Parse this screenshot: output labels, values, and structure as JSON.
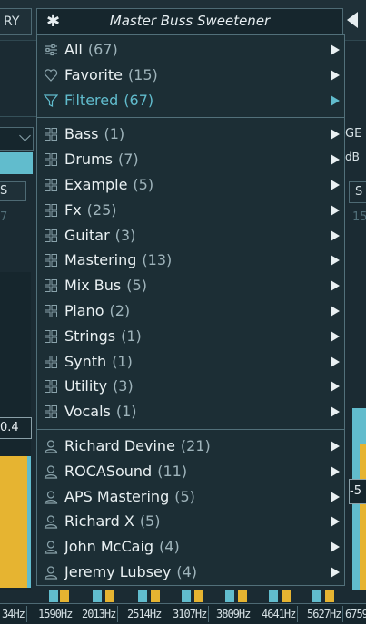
{
  "header": {
    "left_tab_fragment": "RY",
    "preset_icon": "asterisk-icon",
    "preset_title": "Master Buss Sweetener",
    "prev_icon": "triangle-left-icon"
  },
  "background": {
    "right_fragment_1": "GE",
    "right_fragment_2": "dB",
    "left_button_fragment": "S",
    "right_button_fragment": "S",
    "left_dim_fragment": "7",
    "right_dim_fragment": "15",
    "left_meter_value": "0.4",
    "right_meter_value": "-5",
    "frequencies": [
      "34Hz",
      "1590Hz",
      "2013Hz",
      "2514Hz",
      "3107Hz",
      "3809Hz",
      "4641Hz",
      "5627Hz",
      "6759"
    ]
  },
  "menu": {
    "groups": [
      [
        {
          "label": "All",
          "count": "(67)",
          "icon": "sliders-icon",
          "highlight": false
        },
        {
          "label": "Favorite",
          "count": "(15)",
          "icon": "heart-icon",
          "highlight": false
        },
        {
          "label": "Filtered",
          "count": "(67)",
          "icon": "funnel-icon",
          "highlight": true
        }
      ],
      [
        {
          "label": "Bass",
          "count": "(1)",
          "icon": "grid-icon"
        },
        {
          "label": "Drums",
          "count": "(7)",
          "icon": "grid-icon"
        },
        {
          "label": "Example",
          "count": "(5)",
          "icon": "grid-icon"
        },
        {
          "label": "Fx",
          "count": "(25)",
          "icon": "grid-icon"
        },
        {
          "label": "Guitar",
          "count": "(3)",
          "icon": "grid-icon"
        },
        {
          "label": "Mastering",
          "count": "(13)",
          "icon": "grid-icon"
        },
        {
          "label": "Mix Bus",
          "count": "(5)",
          "icon": "grid-icon"
        },
        {
          "label": "Piano",
          "count": "(2)",
          "icon": "grid-icon"
        },
        {
          "label": "Strings",
          "count": "(1)",
          "icon": "grid-icon"
        },
        {
          "label": "Synth",
          "count": "(1)",
          "icon": "grid-icon"
        },
        {
          "label": "Utility",
          "count": "(3)",
          "icon": "grid-icon"
        },
        {
          "label": "Vocals",
          "count": "(1)",
          "icon": "grid-icon"
        }
      ],
      [
        {
          "label": "Richard Devine",
          "count": "(21)",
          "icon": "user-icon"
        },
        {
          "label": "ROCASound",
          "count": "(11)",
          "icon": "user-icon"
        },
        {
          "label": "APS Mastering",
          "count": "(5)",
          "icon": "user-icon"
        },
        {
          "label": "Richard X",
          "count": "(5)",
          "icon": "user-icon"
        },
        {
          "label": "John McCaig",
          "count": "(4)",
          "icon": "user-icon"
        },
        {
          "label": "Jeremy Lubsey",
          "count": "(4)",
          "icon": "user-icon"
        }
      ]
    ]
  },
  "colors": {
    "accent": "#61bccd",
    "meter_yellow": "#e6b431",
    "panel": "#1c2e35"
  }
}
